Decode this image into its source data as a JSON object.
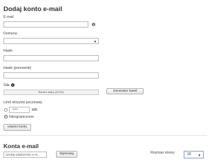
{
  "add_account": {
    "title": "Dodaj konto e-mail",
    "email_label": "E-mail",
    "email_value": "",
    "domain_label": "Domena",
    "domain_value": "",
    "password_label": "Hasło",
    "password_repeat_label": "Hasło (ponownie)",
    "strength_label": "Siła",
    "strength_text": "Bardzo słaby (0/100)",
    "strength_percent": 0,
    "generator_button": "Generator haseł",
    "limit_label": "Limit skrzynki pocztowej",
    "limit_value": "500",
    "limit_unit": "MB",
    "unlimited_label": "Nieograniczone",
    "selected_option": "Nieograniczone",
    "create_button": "Utwórz konto"
  },
  "accounts": {
    "title": "Konta e-mail",
    "search_placeholder": "Szukaj wiadomości e-m...",
    "search_button": "Wyszukaj",
    "page_size_label": "Rozmiar strony",
    "page_size_value": "10"
  },
  "icons": {
    "email_help": "info-icon",
    "strength_help": "info-icon",
    "dropdown": "chevron-down-icon"
  }
}
